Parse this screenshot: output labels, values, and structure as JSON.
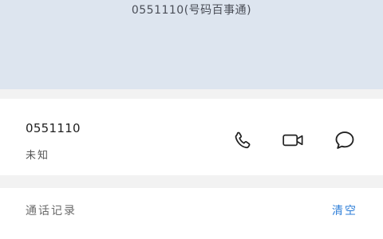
{
  "hero": {
    "subtitle": "0551110(号码百事通)"
  },
  "contact": {
    "number": "0551110",
    "location": "未知",
    "actions": [
      {
        "name": "call-icon"
      },
      {
        "name": "video-call-icon"
      },
      {
        "name": "message-icon"
      }
    ]
  },
  "history": {
    "title": "通话记录",
    "clear_label": "清空"
  },
  "colors": {
    "hero_background": "#dde5ef",
    "accent": "#2f7fd8"
  }
}
